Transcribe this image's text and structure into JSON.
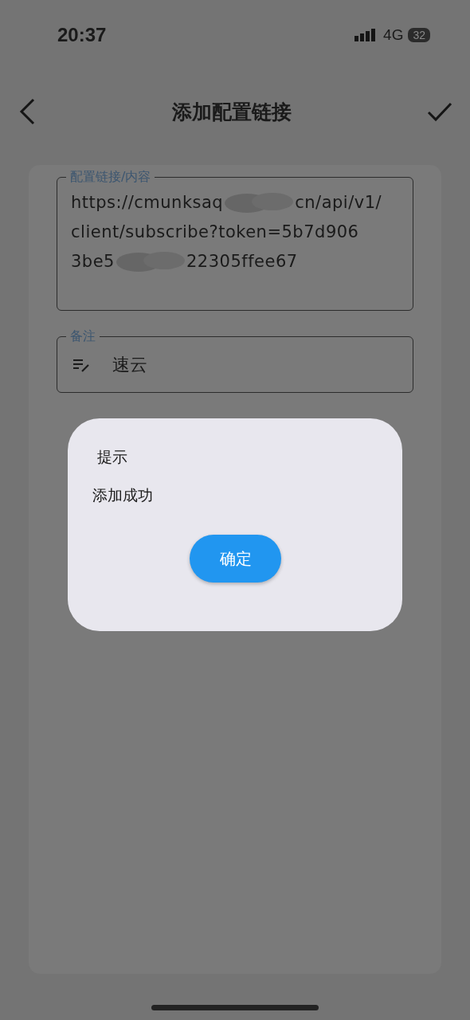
{
  "status_bar": {
    "time": "20:37",
    "network": "4G",
    "battery": "32"
  },
  "header": {
    "title": "添加配置链接"
  },
  "link_field": {
    "label": "配置链接/内容",
    "lines": [
      [
        "https://cmunksaq",
        "cn/api/v1/"
      ],
      [
        "client/subscribe?token=5b7d906"
      ],
      [
        "3be5",
        "22305ffee67"
      ]
    ]
  },
  "note_field": {
    "label": "备注",
    "value": "速云"
  },
  "dialog": {
    "title": "提示",
    "message": "添加成功",
    "button": "确定"
  }
}
